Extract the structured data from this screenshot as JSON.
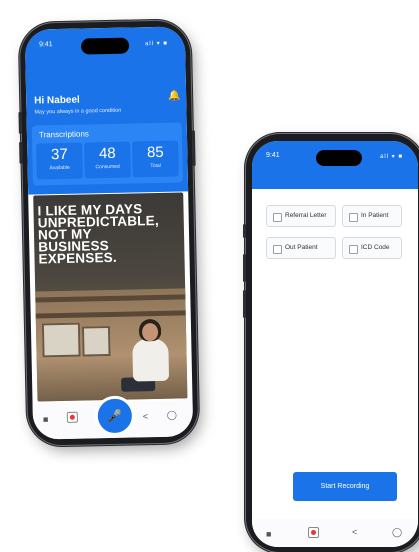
{
  "phone_left": {
    "status": {
      "time": "9:41",
      "icons": "all ▾ ■"
    },
    "greeting": "Hi Nabeel",
    "subgreeting": "May you always in a good condition",
    "transcriptions": {
      "title": "Transcriptions",
      "stats": [
        {
          "value": "37",
          "label": "Available"
        },
        {
          "value": "48",
          "label": "Consumed"
        },
        {
          "value": "85",
          "label": "Total"
        }
      ]
    },
    "ad": {
      "headline_lines": [
        "I LIKE MY DAYS",
        "UNPREDICTABLE,",
        "NOT MY",
        "BUSINESS",
        "EXPENSES."
      ]
    },
    "nav": {
      "mic_icon": "microphone-icon",
      "items": [
        "home-icon",
        "record-icon",
        "share-icon",
        "profile-icon"
      ]
    }
  },
  "phone_right": {
    "status": {
      "time": "9:41",
      "icons": "all ▾ ■"
    },
    "options": [
      {
        "label": "Referral Letter"
      },
      {
        "label": "In Patient"
      },
      {
        "label": "Out Patient"
      },
      {
        "label": "ICD Code"
      }
    ],
    "start_button": "Start Recording",
    "nav": {
      "items": [
        "home-icon",
        "record-icon",
        "share-icon",
        "profile-icon"
      ]
    }
  },
  "colors": {
    "primary": "#1a73e8",
    "card": "#2b85f5",
    "frame": "#1b1c1f"
  }
}
